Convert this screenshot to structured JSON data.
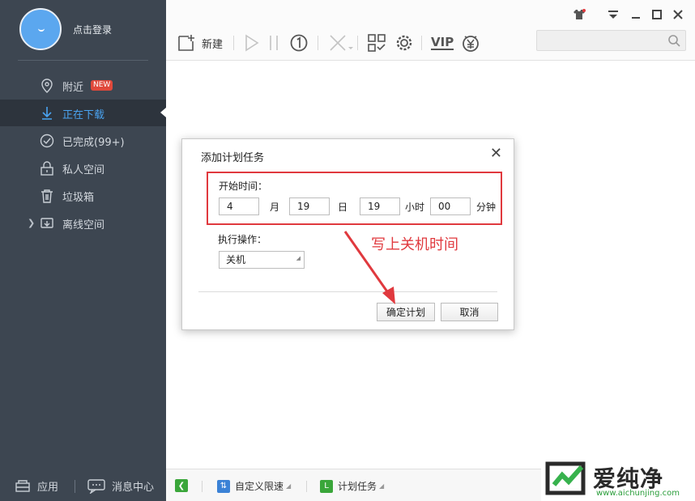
{
  "user": {
    "login_text": "点击登录"
  },
  "sidebar": {
    "items": [
      {
        "label": "附近",
        "badge": "NEW",
        "icon": "location-icon"
      },
      {
        "label": "正在下载",
        "icon": "download-icon",
        "active": true
      },
      {
        "label": "已完成(99+)",
        "icon": "check-circle-icon"
      },
      {
        "label": "私人空间",
        "icon": "lock-icon"
      },
      {
        "label": "垃圾箱",
        "icon": "trash-icon"
      },
      {
        "label": "离线空间",
        "icon": "cloud-icon"
      }
    ],
    "bottom": {
      "apps_label": "应用",
      "messages_label": "消息中心"
    }
  },
  "toolbar": {
    "new_label": "新建",
    "vip_label": "VIP"
  },
  "statusbar": {
    "speed_label": "自定义限速",
    "schedule_label": "计划任务"
  },
  "dialog": {
    "title": "添加计划任务",
    "start_time_label": "开始时间：",
    "month_value": "4",
    "month_unit": "月",
    "day_value": "19",
    "day_unit": "日",
    "hour_value": "19",
    "hour_unit": "小时",
    "minute_value": "00",
    "minute_unit": "分钟",
    "action_label": "执行操作：",
    "action_value": "关机",
    "confirm_label": "确定计划",
    "cancel_label": "取消"
  },
  "annotation": {
    "text": "写上关机时间"
  },
  "watermark": {
    "text": "爱纯净",
    "url": "www.aichunjing.com"
  },
  "colors": {
    "sidebar_bg": "#3d4651",
    "accent": "#4aa3f0",
    "highlight_red": "#e0393e"
  }
}
